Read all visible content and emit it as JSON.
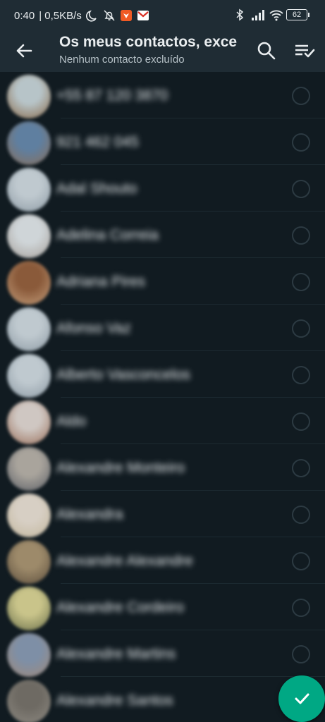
{
  "status": {
    "time": "0:40",
    "speed": "| 0,5KB/s",
    "battery": "62",
    "colors": {
      "brave": "#f05a24",
      "gmail": "#d93025"
    }
  },
  "header": {
    "title": "Os meus contactos, exce",
    "subtitle": "Nenhum contacto excluído"
  },
  "contacts": [
    {
      "name": "+55 87 120 3870",
      "avatar": [
        "#b7c4c8",
        "#8a6a4a"
      ]
    },
    {
      "name": "921 462 045",
      "avatar": [
        "#5f7fa0",
        "#8a6f5a"
      ]
    },
    {
      "name": "Adal Shouto",
      "avatar": [
        "#bfc9cf",
        "#8d9aa4"
      ]
    },
    {
      "name": "Adelina Correia",
      "avatar": [
        "#cfd5d8",
        "#a6a09a"
      ]
    },
    {
      "name": "Adriana Pires",
      "avatar": [
        "#8a5a3a",
        "#c49e7c"
      ]
    },
    {
      "name": "Afonso Vaz",
      "avatar": [
        "#bfc9cf",
        "#8d9aa4"
      ]
    },
    {
      "name": "Alberto Vasconcelos",
      "avatar": [
        "#bfc9cf",
        "#8d9aa4"
      ]
    },
    {
      "name": "Aldo",
      "avatar": [
        "#cfc7c2",
        "#9a6f5a"
      ]
    },
    {
      "name": "Alexandre Monteiro",
      "avatar": [
        "#a9a49c",
        "#5b5f66"
      ]
    },
    {
      "name": "Alexandra",
      "avatar": [
        "#d7cfc4",
        "#c2b69c"
      ]
    },
    {
      "name": "Alexandre Alexandre",
      "avatar": [
        "#9d8a6a",
        "#5c4e3d"
      ]
    },
    {
      "name": "Alexandre Cordeiro",
      "avatar": [
        "#c9c48a",
        "#6a6f4a"
      ]
    },
    {
      "name": "Alexandre Martins",
      "avatar": [
        "#7e8fa6",
        "#a08a7a"
      ]
    },
    {
      "name": "Alexandre Santos",
      "avatar": [
        "#6e6a63",
        "#8e8a82"
      ]
    }
  ],
  "fab": {
    "color": "#00a884"
  }
}
